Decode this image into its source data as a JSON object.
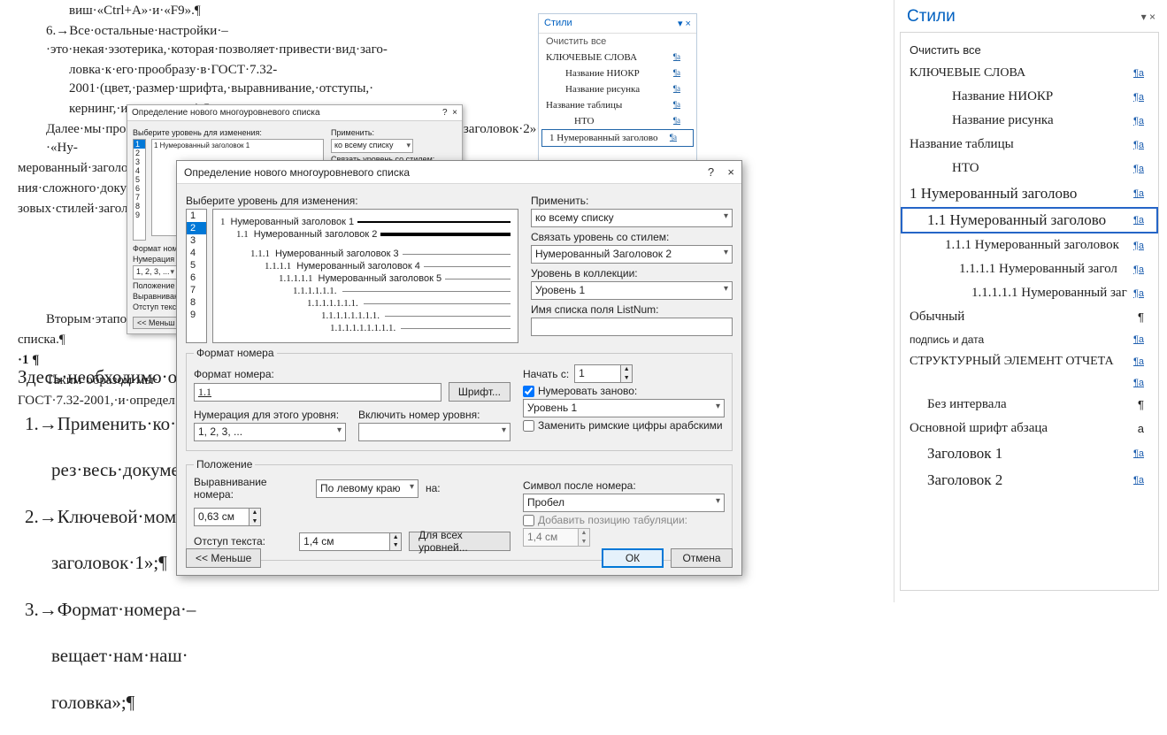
{
  "doc": {
    "l0": "виш·«Ctrl+A»·и·«F9».¶",
    "l1": "6.→Все·остальные·настройки·–·это·некая·эзотерика,·которая·позволяет·привести·вид·заго-",
    "l2": "ловка·к·его·прообразу·в·ГОСТ·7.32-2001·(цвет,·размер·шрифта,·выравнивание,·отступы,·",
    "l3": "кернинг,·интерлиньяж).¶",
    "l4": "Далее·мы·просто·создаем·подобным·же·образом·стили·«Нумерованный·заголовок·2»·–·«Ну-",
    "l5": "мерованный·заголовок·5».·Как·правило,·пяти·уровней·нумерованных·заголовков·хватает·для·созда-",
    "l6": "ния·сложного·документа·с",
    "l7": "зовых·стилей·заголовков·«З",
    "l8": "Вторым·этапом·наст",
    "l9": "списка.¶",
    "l10": "·1 ¶",
    "l11": "Таким·образом·мы·",
    "l12": "ГОСТ·7.32-2001,·и·определ",
    "h1": "Здесь·необходимо·от",
    "p1": "1.→Применить·ко·вс",
    "p1b": "рез·весь·докумен",
    "p2": "2.→Ключевой·момен",
    "p2b": "заголовок·1»;¶",
    "p3": "3.→Формат·номера·–",
    "p3b": "вещает·нам·наш·",
    "p3c": "головка»;¶"
  },
  "dlgSmall": {
    "title": "Определение нового многоуровневого списка",
    "help": "?",
    "close": "×",
    "levelLabel": "Выберите уровень для изменения:",
    "applyLabel": "Применить:",
    "applyVal": "ко всему списку",
    "linkLabel": "Связать уровень со стилем:",
    "fmtLbl": "Формат номера",
    "numLbl": "Нумерация",
    "numVal": "1, 2, 3, ...",
    "posLbl": "Положение",
    "alignLbl": "Выравнивани",
    "indentLbl": "Отступ текст",
    "lessBtn": "<< Меньш",
    "preview1": "1  Нумерованный заголовок 1"
  },
  "dlgMain": {
    "title": "Определение нового многоуровневого списка",
    "help": "?",
    "close": "×",
    "levelLabel": "Выберите уровень для изменения:",
    "levels": [
      "1",
      "2",
      "3",
      "4",
      "5",
      "6",
      "7",
      "8",
      "9"
    ],
    "selectedLevel": "2",
    "preview": {
      "l1n": "1",
      "l1t": "Нумерованный заголовок 1",
      "l2n": "1.1",
      "l2t": "Нумерованный заголовок 2",
      "l3n": "1.1.1",
      "l3t": "Нумерованный заголовок 3",
      "l4n": "1.1.1.1",
      "l4t": "Нумерованный заголовок 4",
      "l5n": "1.1.1.1.1",
      "l5t": "Нумерованный заголовок 5",
      "l6n": "1.1.1.1.1.1.",
      "l7n": "1.1.1.1.1.1.1.",
      "l8n": "1.1.1.1.1.1.1.1.",
      "l9n": "1.1.1.1.1.1.1.1.1."
    },
    "applyLabel": "Применить:",
    "applyVal": "ко всему списку",
    "linkLabel": "Связать уровень со стилем:",
    "linkVal": "Нумерованный Заголовок 2",
    "galleryLabel": "Уровень в коллекции:",
    "galleryVal": "Уровень 1",
    "listNumLabel": "Имя списка поля ListNum:",
    "listNumVal": "",
    "fmtLegend": "Формат номера",
    "fmtLabel": "Формат номера:",
    "fmtVal": "1.1",
    "fontBtn": "Шрифт...",
    "numStyleLabel": "Нумерация для этого уровня:",
    "numStyleVal": "1, 2, 3, ...",
    "includeLabel": "Включить номер уровня:",
    "includeVal": "",
    "startLabel": "Начать с:",
    "startVal": "1",
    "restartChk": "Нумеровать заново:",
    "restartVal": "Уровень 1",
    "romanChk": "Заменить римские цифры арабскими",
    "posLegend": "Положение",
    "alignLabel": "Выравнивание номера:",
    "alignVal": "По левому краю",
    "atLabel": "на:",
    "atVal": "0,63 см",
    "indentLabel": "Отступ текста:",
    "indentVal": "1,4 см",
    "allLevelsBtn": "Для всех уровней...",
    "afterLabel": "Символ после номера:",
    "afterVal": "Пробел",
    "tabChk": "Добавить позицию табуляции:",
    "tabVal": "1,4 см",
    "lessBtn": "<< Меньше",
    "okBtn": "ОК",
    "cancelBtn": "Отмена"
  },
  "pane1": {
    "title": "Стили",
    "pin": "▾ ×",
    "clear": "Очистить все",
    "items": [
      {
        "t": "КЛЮЧЕВЫЕ СЛОВА",
        "m": "¶a"
      },
      {
        "t": "Название НИОКР",
        "m": "¶a"
      },
      {
        "t": "Название рисунка",
        "m": "¶a"
      },
      {
        "t": "Название таблицы",
        "m": "¶a"
      },
      {
        "t": "НТО",
        "m": "¶a"
      },
      {
        "t": "1  Нумерованный заголово",
        "m": "¶a"
      }
    ]
  },
  "pane2": {
    "title": "Стили",
    "pin": "▾ ×",
    "clear": "Очистить все",
    "items": [
      {
        "t": "КЛЮЧЕВЫЕ СЛОВА",
        "m": "¶a",
        "cls": "kws"
      },
      {
        "t": "Название НИОКР",
        "m": "¶a",
        "cls": "ind2"
      },
      {
        "t": "Название рисунка",
        "m": "¶a",
        "cls": "ind2"
      },
      {
        "t": "Название таблицы",
        "m": "¶a",
        "cls": ""
      },
      {
        "t": "НТО",
        "m": "¶a",
        "cls": "ind2"
      },
      {
        "t": "1  Нумерованный заголово",
        "m": "¶a",
        "cls": "nhh"
      },
      {
        "t": "1.1  Нумерованный заголово",
        "m": "¶a",
        "cls": "ind1 nhh boxed"
      },
      {
        "t": "1.1.1  Нумерованный заголовок",
        "m": "¶a",
        "cls": "ind3"
      },
      {
        "t": "1.1.1.1  Нумерованный загол",
        "m": "¶a",
        "cls": "ind4"
      },
      {
        "t": "1.1.1.1.1  Нумерованный заг",
        "m": "¶a",
        "cls": "ind5"
      },
      {
        "t": "Обычный",
        "m": "¶",
        "cls": ""
      },
      {
        "t": "подпись и дата",
        "m": "¶a",
        "cls": "small"
      },
      {
        "t": "СТРУКТУРНЫЙ ЭЛЕМЕНТ ОТЧЕТА",
        "m": "¶a",
        "cls": "kws"
      },
      {
        "t": "",
        "m": "¶a",
        "cls": ""
      },
      {
        "t": "Без интервала",
        "m": "¶",
        "cls": "ind1"
      },
      {
        "t": "Основной шрифт абзаца",
        "m": "a",
        "cls": ""
      },
      {
        "t": "Заголовок 1",
        "m": "¶a",
        "cls": "ind1 nhh"
      },
      {
        "t": "Заголовок 2",
        "m": "¶a",
        "cls": "ind1 nhh"
      }
    ]
  }
}
